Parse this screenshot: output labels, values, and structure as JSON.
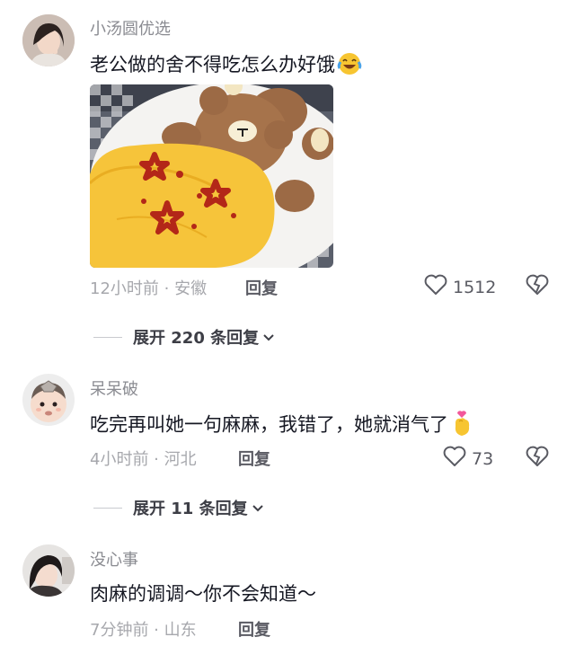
{
  "comments": [
    {
      "username": "小汤圆优选",
      "text": "老公做的舍不得吃怎么办好饿",
      "emoji": "crying-laugh-emoji",
      "image": "omelette-rice-bear-photo",
      "time_location": "12小时前 · 安徽",
      "reply_label": "回复",
      "likes": "1512",
      "expand_label": "展开 220 条回复"
    },
    {
      "username": "呆呆破",
      "text": "吃完再叫她一句麻麻，我错了，她就消气了",
      "emoji": "pinched-heart-emoji",
      "time_location": "4小时前 · 河北",
      "reply_label": "回复",
      "likes": "73",
      "expand_label": "展开 11 条回复"
    },
    {
      "username": "没心事",
      "text": "肉麻的调调～你不会知道～",
      "time_location": "7分钟前 · 山东",
      "reply_label": "回复"
    }
  ],
  "colors": {
    "background": "#ffffff",
    "username": "#8a8b91",
    "text": "#161823",
    "meta": "#a7a8ad"
  }
}
